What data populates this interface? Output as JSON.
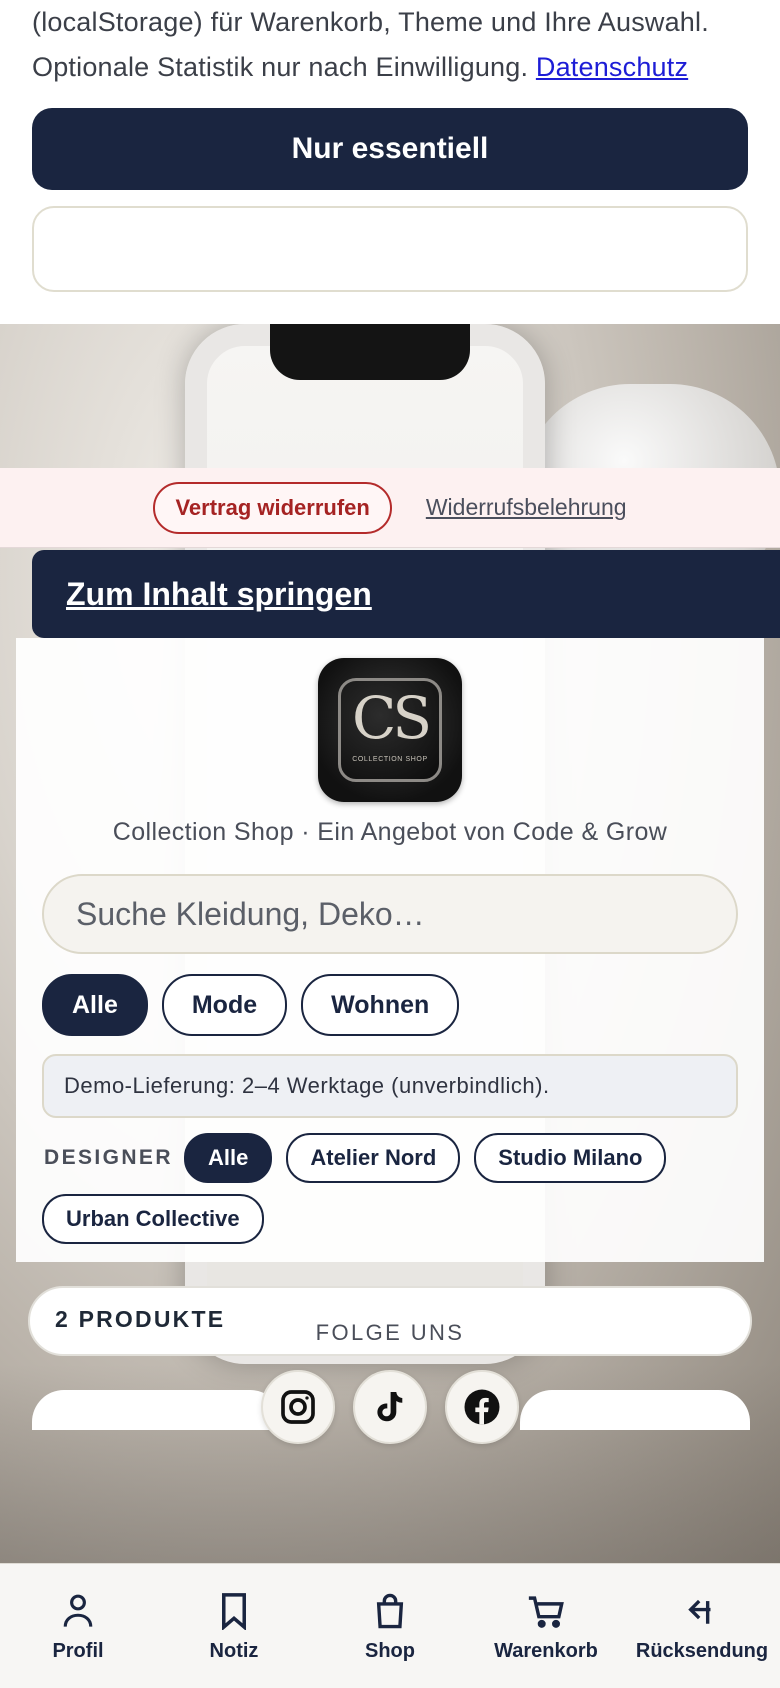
{
  "cookie": {
    "text_line1": "(localStorage) für Warenkorb, Theme und Ihre Auswahl.",
    "text_line2": "Optionale Statistik nur nach Einwilligung.",
    "privacy_link": "Datenschutz",
    "essential_button": "Nur essentiell"
  },
  "revoke": {
    "button": "Vertrag widerrufen",
    "link": "Widerrufsbelehrung"
  },
  "skip_link": "Zum Inhalt springen",
  "logo": {
    "monogram": "CS",
    "subtitle": "COLLECTION SHOP"
  },
  "tagline": "Collection Shop · Ein Angebot von Code & Grow",
  "search": {
    "placeholder": "Suche Kleidung, Deko…",
    "value": ""
  },
  "categories": [
    "Alle",
    "Mode",
    "Wohnen"
  ],
  "delivery_notice": "Demo-Lieferung: 2–4 Werktage (unverbindlich).",
  "designer": {
    "label": "DESIGNER",
    "options": [
      "Alle",
      "Atelier Nord",
      "Studio Milano",
      "Urban Collective"
    ]
  },
  "product_count": "2 PRODUKTE",
  "follow_label": "FOLGE UNS",
  "social": [
    "instagram-icon",
    "tiktok-icon",
    "facebook-icon"
  ],
  "nav": {
    "profile": "Profil",
    "note": "Notiz",
    "shop": "Shop",
    "cart": "Warenkorb",
    "returns": "Rücksendung"
  },
  "colors": {
    "primary": "#1a2540",
    "revoke_red": "#b42b2b",
    "link_blue": "#1d1dd6"
  }
}
